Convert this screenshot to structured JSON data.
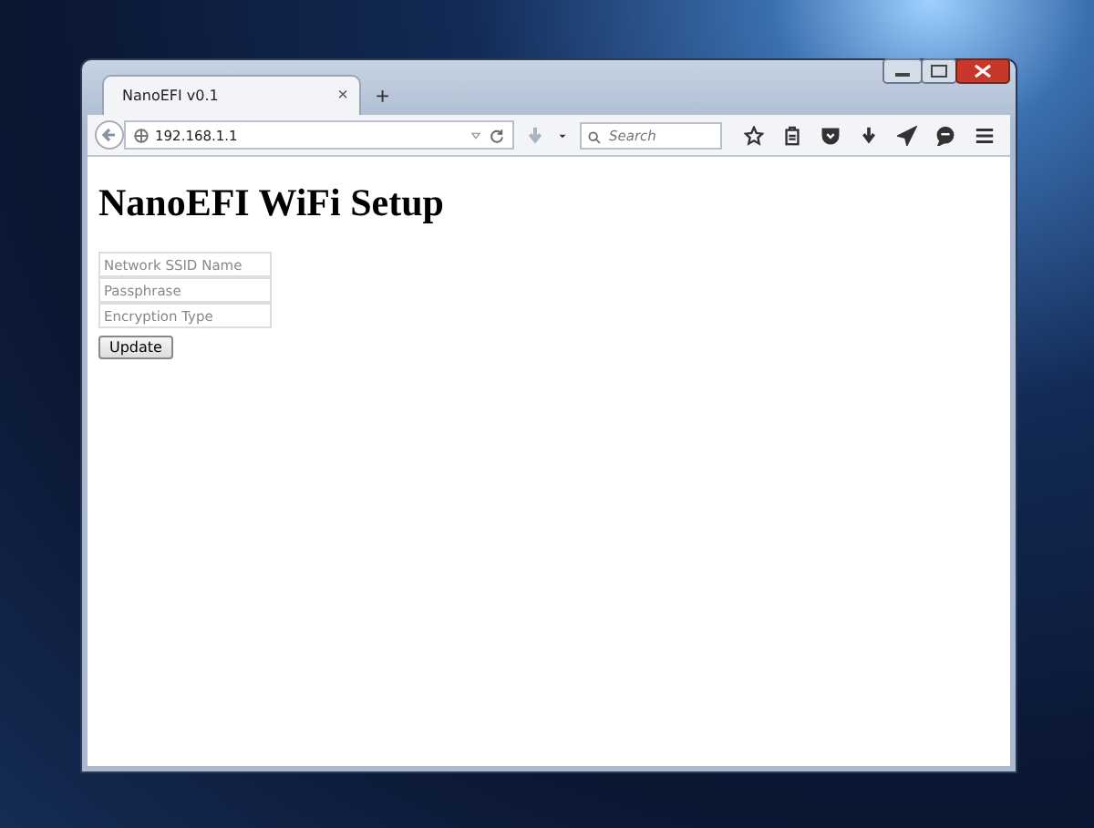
{
  "browser": {
    "tabs": [
      {
        "title": "NanoEFI v0.1",
        "close": "×",
        "selected": true
      }
    ],
    "new_tab": "+",
    "address": "192.168.1.1",
    "search": {
      "placeholder": "Search"
    }
  },
  "page": {
    "heading": "NanoEFI WiFi Setup",
    "fields": [
      {
        "placeholder": "Network SSID Name"
      },
      {
        "placeholder": "Passphrase"
      },
      {
        "placeholder": "Encryption Type"
      }
    ],
    "button": "Update"
  }
}
